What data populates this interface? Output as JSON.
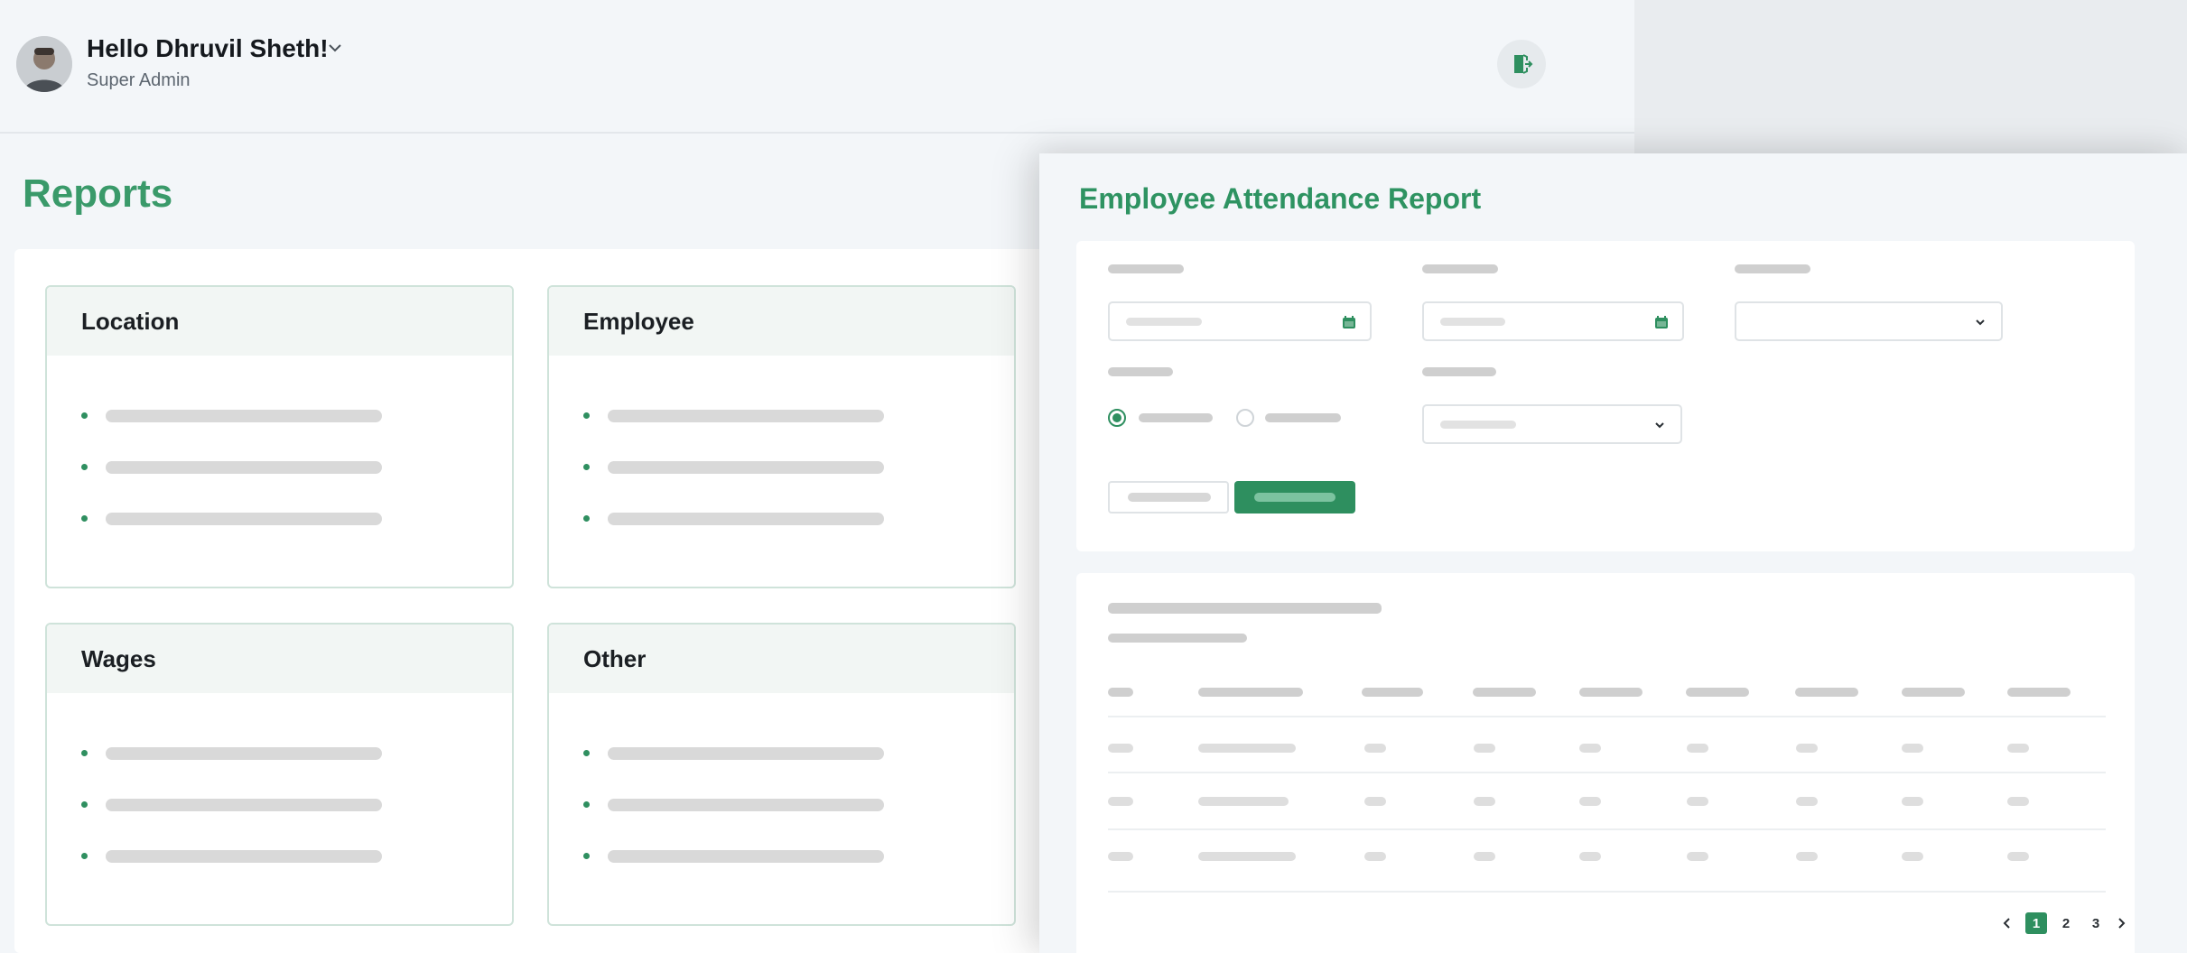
{
  "header": {
    "greeting": "Hello Dhruvil Sheth!",
    "role": "Super Admin",
    "avatar_icon": "user-avatar",
    "dropdown_icon": "chevron-down-icon",
    "logout_icon": "logout-icon"
  },
  "page": {
    "title": "Reports"
  },
  "categories": [
    {
      "title": "Location"
    },
    {
      "title": "Employee"
    },
    {
      "title": "Wages"
    },
    {
      "title": "Other"
    }
  ],
  "report": {
    "title": "Employee Attendance Report",
    "pagination": {
      "pages": [
        "1",
        "2",
        "3"
      ],
      "current": "1",
      "prev_icon": "chevron-left-icon",
      "next_icon": "chevron-right-icon"
    }
  },
  "colors": {
    "accent": "#2e8f5f",
    "title_green": "#3a9a6a",
    "placeholder": "#d9d9d9"
  }
}
